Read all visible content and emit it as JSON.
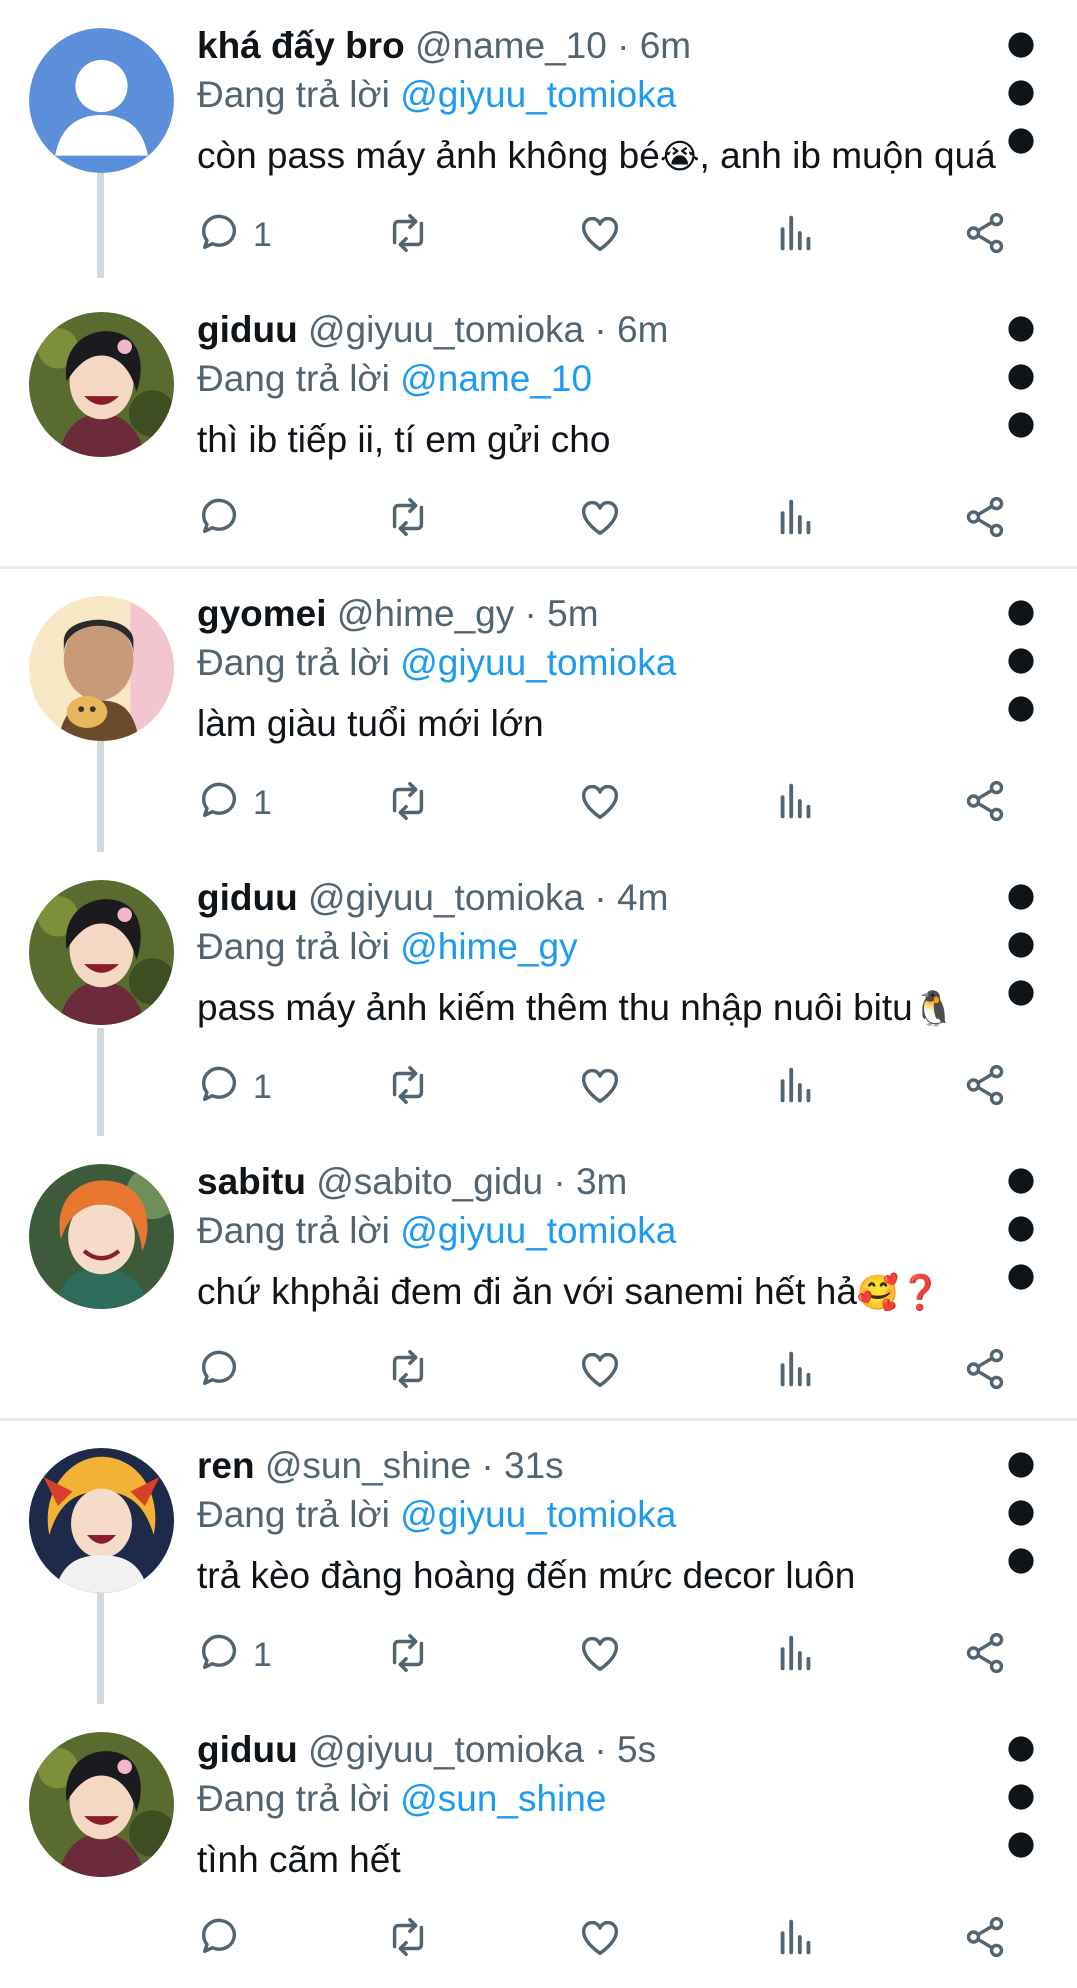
{
  "reply_prefix": "Đang trả lời",
  "colors": {
    "text": "#0f1419",
    "muted": "#536471",
    "link": "#1d9bf0",
    "thread": "#cfd9de"
  },
  "icons": {
    "reply": "reply-icon",
    "retweet": "retweet-icon",
    "like": "heart-icon",
    "views": "views-icon",
    "share": "share-icon",
    "more": "more-vertical-icon"
  },
  "tweets": [
    {
      "display_name": "khá đấy bro",
      "handle": "@name_10",
      "time": "6m",
      "replying_to": "@giyuu_tomioka",
      "text": "còn pass máy ảnh không bé",
      "text_emoji": "😭",
      "text_after": ", anh ib muộn quá",
      "reply_count": "1",
      "avatar": "default"
    },
    {
      "display_name": "giduu",
      "handle": "@giyuu_tomioka",
      "time": "6m",
      "replying_to": "@name_10",
      "text": "thì ib tiếp ii, tí em gửi cho",
      "text_emoji": "",
      "text_after": "",
      "reply_count": "",
      "avatar": "giyuu"
    },
    {
      "display_name": "gyomei",
      "handle": "@hime_gy",
      "time": "5m",
      "replying_to": "@giyuu_tomioka",
      "text": "làm giàu tuổi mới lớn",
      "text_emoji": "",
      "text_after": "",
      "reply_count": "1",
      "avatar": "gyomei"
    },
    {
      "display_name": "giduu",
      "handle": "@giyuu_tomioka",
      "time": "4m",
      "replying_to": "@hime_gy",
      "text": "pass máy ảnh kiếm thêm thu nhập nuôi bitu",
      "text_emoji": "🐧",
      "text_after": "",
      "reply_count": "1",
      "avatar": "giyuu"
    },
    {
      "display_name": "sabitu",
      "handle": "@sabito_gidu",
      "time": "3m",
      "replying_to": "@giyuu_tomioka",
      "text": "chứ khphải đem đi ăn với sanemi hết hả",
      "text_emoji": "🥰❓",
      "text_after": "",
      "reply_count": "",
      "avatar": "sabito"
    },
    {
      "display_name": "ren",
      "handle": "@sun_shine",
      "time": "31s",
      "replying_to": "@giyuu_tomioka",
      "text": "trả kèo đàng hoàng đến mức decor luôn",
      "text_emoji": "",
      "text_after": "",
      "reply_count": "1",
      "avatar": "rengoku"
    },
    {
      "display_name": "giduu",
      "handle": "@giyuu_tomioka",
      "time": "5s",
      "replying_to": "@sun_shine",
      "text": "tình cãm hết",
      "text_emoji": "",
      "text_after": "",
      "reply_count": "",
      "avatar": "giyuu"
    }
  ]
}
